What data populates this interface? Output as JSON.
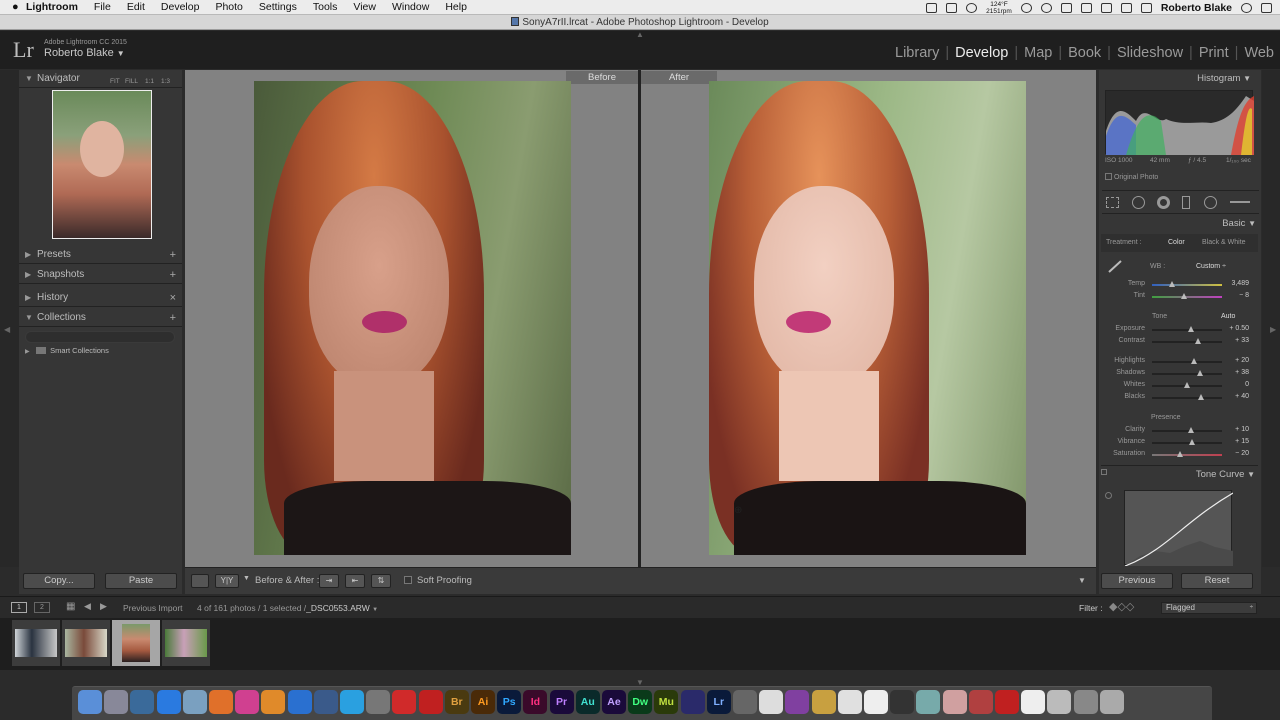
{
  "mac_menu": {
    "app": "Lightroom",
    "items": [
      "File",
      "Edit",
      "Develop",
      "Photo",
      "Settings",
      "Tools",
      "View",
      "Window",
      "Help"
    ],
    "temp": "124°F",
    "rpm": "2151rpm",
    "user": "Roberto Blake"
  },
  "window_title": "SonyA7rII.lrcat - Adobe Photoshop Lightroom - Develop",
  "identity": {
    "product": "Adobe Lightroom CC 2015",
    "user": "Roberto Blake",
    "logo": "Lr"
  },
  "modules": {
    "library": "Library",
    "develop": "Develop",
    "map": "Map",
    "book": "Book",
    "slideshow": "Slideshow",
    "print": "Print",
    "web": "Web"
  },
  "left_panel": {
    "navigator": "Navigator",
    "nav_fit": "FIT",
    "nav_fill": "FILL",
    "nav_1to1": "1:1",
    "nav_1to3": "1:3",
    "presets": "Presets",
    "snapshots": "Snapshots",
    "history": "History",
    "collections": "Collections",
    "smart_collections": "Smart Collections",
    "copy": "Copy...",
    "paste": "Paste"
  },
  "view": {
    "before": "Before",
    "after": "After"
  },
  "toolbar": {
    "yy": "Y|Y",
    "before_after": "Before & After :",
    "soft_proofing": "Soft Proofing"
  },
  "right_panel": {
    "histogram": "Histogram",
    "exif": {
      "iso": "ISO 1000",
      "focal": "42 mm",
      "aperture": "ƒ / 4.5",
      "shutter": "1/₁₀₀ sec"
    },
    "original_photo": "Original Photo",
    "basic": "Basic",
    "treatment_label": "Treatment :",
    "treatment_color": "Color",
    "treatment_bw": "Black & White",
    "wb_label": "WB :",
    "wb_value": "Custom",
    "tone_label": "Tone",
    "auto": "Auto",
    "presence_label": "Presence",
    "tone_curve": "Tone Curve",
    "previous": "Previous",
    "reset": "Reset",
    "sliders": [
      {
        "label": "Temp",
        "value": "3,489",
        "pos": 0.28
      },
      {
        "label": "Tint",
        "value": "− 8",
        "pos": 0.46
      },
      {
        "label": "Exposure",
        "value": "+ 0.50",
        "pos": 0.55
      },
      {
        "label": "Contrast",
        "value": "+ 33",
        "pos": 0.66
      },
      {
        "label": "Highlights",
        "value": "+ 20",
        "pos": 0.6
      },
      {
        "label": "Shadows",
        "value": "+ 38",
        "pos": 0.69
      },
      {
        "label": "Whites",
        "value": "0",
        "pos": 0.5
      },
      {
        "label": "Blacks",
        "value": "+ 40",
        "pos": 0.7
      },
      {
        "label": "Clarity",
        "value": "+ 10",
        "pos": 0.55
      },
      {
        "label": "Vibrance",
        "value": "+ 15",
        "pos": 0.57
      },
      {
        "label": "Saturation",
        "value": "− 20",
        "pos": 0.4
      }
    ]
  },
  "filmstrip": {
    "source": "Previous Import",
    "info": "4 of 161 photos / 1 selected /",
    "filename": "_DSC0553.ARW",
    "filter_label": "Filter :",
    "filter_value": "Flagged",
    "view1": "1",
    "view2": "2"
  },
  "dock": [
    "Finder",
    "Launchpad",
    "Mission",
    "App Store",
    "Preview",
    "Firefox",
    "iTunes",
    "iBooks",
    "Dropbox",
    "QuickTime",
    "Skype",
    "Settings",
    "Creative Cloud",
    "Acrobat",
    "Br",
    "Ai",
    "Ps",
    "Id",
    "Pr",
    "Au",
    "Ae",
    "Dw",
    "Mu",
    "Edge",
    "Lr",
    "Photos",
    "Notes",
    "OneNote",
    "Pencil",
    "Chrome",
    "Calendar",
    "Piano",
    "Photos2",
    "Pages",
    "Pixelmator",
    "FileZilla",
    "TextEdit",
    "Files",
    "Disk",
    "Trash"
  ]
}
